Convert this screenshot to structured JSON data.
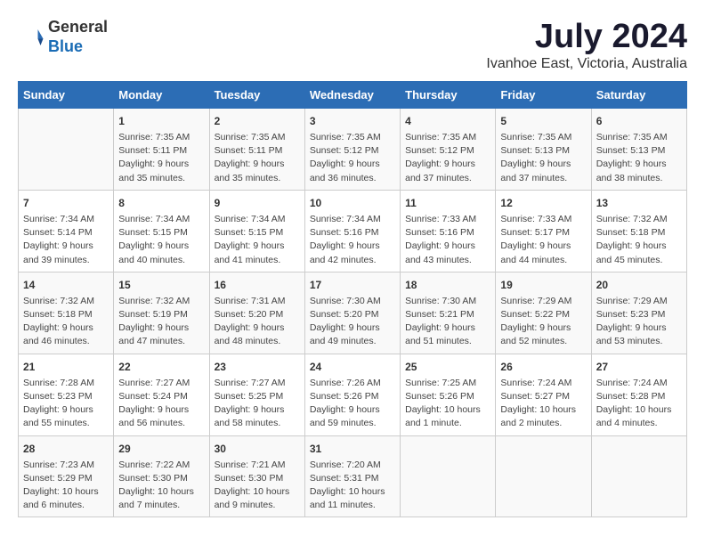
{
  "header": {
    "logo_line1": "General",
    "logo_line2": "Blue",
    "month_year": "July 2024",
    "location": "Ivanhoe East, Victoria, Australia"
  },
  "weekdays": [
    "Sunday",
    "Monday",
    "Tuesday",
    "Wednesday",
    "Thursday",
    "Friday",
    "Saturday"
  ],
  "weeks": [
    [
      {
        "day": "",
        "info": ""
      },
      {
        "day": "1",
        "info": "Sunrise: 7:35 AM\nSunset: 5:11 PM\nDaylight: 9 hours\nand 35 minutes."
      },
      {
        "day": "2",
        "info": "Sunrise: 7:35 AM\nSunset: 5:11 PM\nDaylight: 9 hours\nand 35 minutes."
      },
      {
        "day": "3",
        "info": "Sunrise: 7:35 AM\nSunset: 5:12 PM\nDaylight: 9 hours\nand 36 minutes."
      },
      {
        "day": "4",
        "info": "Sunrise: 7:35 AM\nSunset: 5:12 PM\nDaylight: 9 hours\nand 37 minutes."
      },
      {
        "day": "5",
        "info": "Sunrise: 7:35 AM\nSunset: 5:13 PM\nDaylight: 9 hours\nand 37 minutes."
      },
      {
        "day": "6",
        "info": "Sunrise: 7:35 AM\nSunset: 5:13 PM\nDaylight: 9 hours\nand 38 minutes."
      }
    ],
    [
      {
        "day": "7",
        "info": "Sunrise: 7:34 AM\nSunset: 5:14 PM\nDaylight: 9 hours\nand 39 minutes."
      },
      {
        "day": "8",
        "info": "Sunrise: 7:34 AM\nSunset: 5:15 PM\nDaylight: 9 hours\nand 40 minutes."
      },
      {
        "day": "9",
        "info": "Sunrise: 7:34 AM\nSunset: 5:15 PM\nDaylight: 9 hours\nand 41 minutes."
      },
      {
        "day": "10",
        "info": "Sunrise: 7:34 AM\nSunset: 5:16 PM\nDaylight: 9 hours\nand 42 minutes."
      },
      {
        "day": "11",
        "info": "Sunrise: 7:33 AM\nSunset: 5:16 PM\nDaylight: 9 hours\nand 43 minutes."
      },
      {
        "day": "12",
        "info": "Sunrise: 7:33 AM\nSunset: 5:17 PM\nDaylight: 9 hours\nand 44 minutes."
      },
      {
        "day": "13",
        "info": "Sunrise: 7:32 AM\nSunset: 5:18 PM\nDaylight: 9 hours\nand 45 minutes."
      }
    ],
    [
      {
        "day": "14",
        "info": "Sunrise: 7:32 AM\nSunset: 5:18 PM\nDaylight: 9 hours\nand 46 minutes."
      },
      {
        "day": "15",
        "info": "Sunrise: 7:32 AM\nSunset: 5:19 PM\nDaylight: 9 hours\nand 47 minutes."
      },
      {
        "day": "16",
        "info": "Sunrise: 7:31 AM\nSunset: 5:20 PM\nDaylight: 9 hours\nand 48 minutes."
      },
      {
        "day": "17",
        "info": "Sunrise: 7:30 AM\nSunset: 5:20 PM\nDaylight: 9 hours\nand 49 minutes."
      },
      {
        "day": "18",
        "info": "Sunrise: 7:30 AM\nSunset: 5:21 PM\nDaylight: 9 hours\nand 51 minutes."
      },
      {
        "day": "19",
        "info": "Sunrise: 7:29 AM\nSunset: 5:22 PM\nDaylight: 9 hours\nand 52 minutes."
      },
      {
        "day": "20",
        "info": "Sunrise: 7:29 AM\nSunset: 5:23 PM\nDaylight: 9 hours\nand 53 minutes."
      }
    ],
    [
      {
        "day": "21",
        "info": "Sunrise: 7:28 AM\nSunset: 5:23 PM\nDaylight: 9 hours\nand 55 minutes."
      },
      {
        "day": "22",
        "info": "Sunrise: 7:27 AM\nSunset: 5:24 PM\nDaylight: 9 hours\nand 56 minutes."
      },
      {
        "day": "23",
        "info": "Sunrise: 7:27 AM\nSunset: 5:25 PM\nDaylight: 9 hours\nand 58 minutes."
      },
      {
        "day": "24",
        "info": "Sunrise: 7:26 AM\nSunset: 5:26 PM\nDaylight: 9 hours\nand 59 minutes."
      },
      {
        "day": "25",
        "info": "Sunrise: 7:25 AM\nSunset: 5:26 PM\nDaylight: 10 hours\nand 1 minute."
      },
      {
        "day": "26",
        "info": "Sunrise: 7:24 AM\nSunset: 5:27 PM\nDaylight: 10 hours\nand 2 minutes."
      },
      {
        "day": "27",
        "info": "Sunrise: 7:24 AM\nSunset: 5:28 PM\nDaylight: 10 hours\nand 4 minutes."
      }
    ],
    [
      {
        "day": "28",
        "info": "Sunrise: 7:23 AM\nSunset: 5:29 PM\nDaylight: 10 hours\nand 6 minutes."
      },
      {
        "day": "29",
        "info": "Sunrise: 7:22 AM\nSunset: 5:30 PM\nDaylight: 10 hours\nand 7 minutes."
      },
      {
        "day": "30",
        "info": "Sunrise: 7:21 AM\nSunset: 5:30 PM\nDaylight: 10 hours\nand 9 minutes."
      },
      {
        "day": "31",
        "info": "Sunrise: 7:20 AM\nSunset: 5:31 PM\nDaylight: 10 hours\nand 11 minutes."
      },
      {
        "day": "",
        "info": ""
      },
      {
        "day": "",
        "info": ""
      },
      {
        "day": "",
        "info": ""
      }
    ]
  ]
}
